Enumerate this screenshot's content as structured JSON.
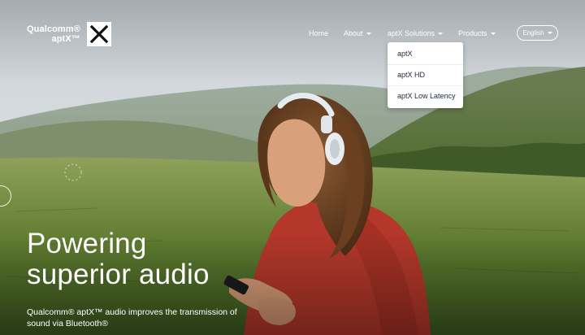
{
  "brand": {
    "line1": "Qualcomm®",
    "line2": "aptX™",
    "logo_icon": "x-icon"
  },
  "nav": {
    "items": [
      {
        "label": "Home",
        "has_caret": false
      },
      {
        "label": "About",
        "has_caret": true
      },
      {
        "label": "aptX Solutions",
        "has_caret": true
      },
      {
        "label": "Products",
        "has_caret": true
      }
    ],
    "language": "English"
  },
  "dropdown": {
    "items": [
      "aptX",
      "aptX HD",
      "aptX Low Latency"
    ]
  },
  "hero": {
    "headline_line1": "Powering",
    "headline_line2": "superior audio",
    "subtext": "Qualcomm® aptX™ audio improves the transmission of sound via Bluetooth®"
  },
  "colors": {
    "dropdown_text": "#1e2a3a",
    "jacket": "#b8392c",
    "sky": "#d7dde0",
    "grass": "#6f8a3c"
  }
}
